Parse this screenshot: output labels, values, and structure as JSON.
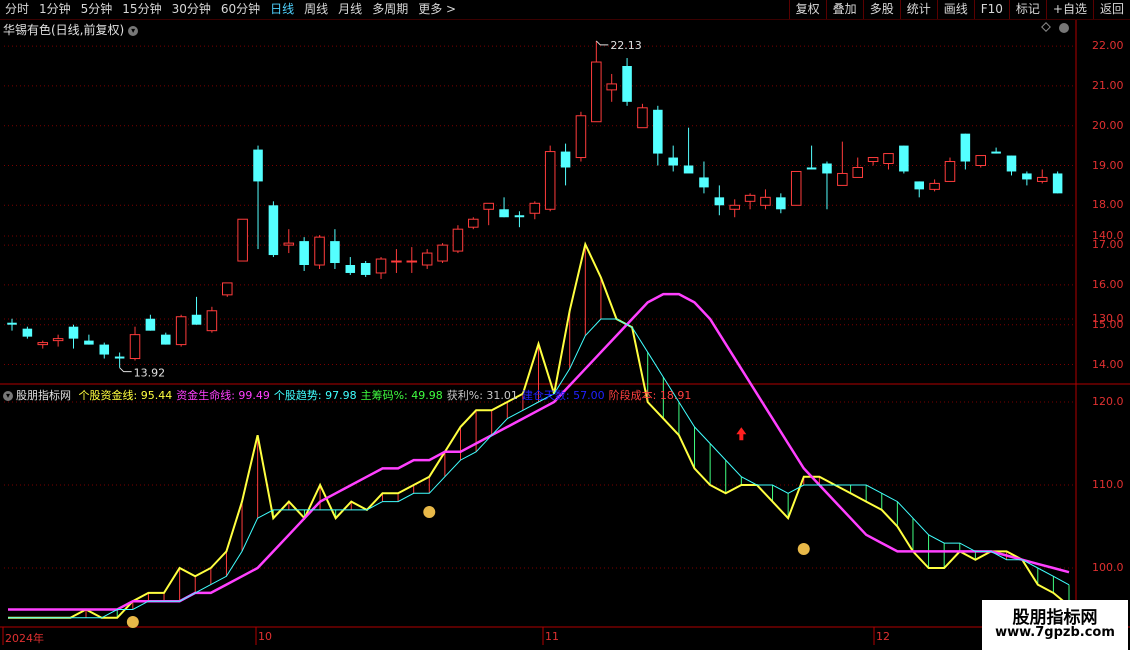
{
  "toolbar": {
    "periods": [
      "分时",
      "1分钟",
      "5分钟",
      "15分钟",
      "30分钟",
      "60分钟",
      "日线",
      "周线",
      "月线",
      "多周期",
      "更多 >"
    ],
    "active_period": "日线",
    "right_buttons": [
      "复权",
      "叠加",
      "多股",
      "统计",
      "画线",
      "F10",
      "标记",
      "+自选",
      "返回"
    ]
  },
  "main_title": "华锡有色(日线,前复权)",
  "price_axis": [
    "22.00",
    "21.00",
    "20.00",
    "19.00",
    "18.00",
    "17.00",
    "16.00",
    "15.00",
    "14.00"
  ],
  "price_high_label": "22.13",
  "price_low_label": "13.92",
  "indicator": {
    "name": "股朋指标网",
    "items": [
      {
        "label": "个股资金线: ",
        "value": "95.44",
        "color": "#ffff40"
      },
      {
        "label": "资金生命线: ",
        "value": "99.49",
        "color": "#ff40ff"
      },
      {
        "label": "个股趋势: ",
        "value": "97.98",
        "color": "#40ffff"
      },
      {
        "label": "主筹码%: ",
        "value": "49.98",
        "color": "#40ff40"
      },
      {
        "label": "获利%: ",
        "value": "31.01",
        "color": "#c8c8c8"
      },
      {
        "label": "建仓天数: ",
        "value": "57.00",
        "color": "#2020ff"
      },
      {
        "label": "阶段成本: ",
        "value": "18.91",
        "color": "#ff4040"
      }
    ]
  },
  "indicator_axis": [
    "140.0",
    "130.0",
    "120.0",
    "110.0",
    "100.0"
  ],
  "date_axis": [
    "2024年",
    "10",
    "11",
    "12"
  ],
  "watermark": {
    "line1": "股朋指标网",
    "line2": "www.7gpzb.com"
  },
  "colors": {
    "up": "#ff3c3c",
    "down": "#54ffff",
    "grid": "#7a0000",
    "axis": "#b00000"
  },
  "chart_data": {
    "type": "candlestick",
    "note": "daily OHLC, prices in CNY",
    "ohlc": [
      [
        15.05,
        15.15,
        14.85,
        15.0
      ],
      [
        14.9,
        14.95,
        14.65,
        14.7
      ],
      [
        14.5,
        14.6,
        14.4,
        14.55
      ],
      [
        14.6,
        14.75,
        14.45,
        14.65
      ],
      [
        14.95,
        15.0,
        14.4,
        14.65
      ],
      [
        14.6,
        14.75,
        14.5,
        14.5
      ],
      [
        14.5,
        14.55,
        14.15,
        14.25
      ],
      [
        14.2,
        14.3,
        13.92,
        14.15
      ],
      [
        14.15,
        14.95,
        14.1,
        14.75
      ],
      [
        15.15,
        15.25,
        14.85,
        14.85
      ],
      [
        14.75,
        14.8,
        14.5,
        14.5
      ],
      [
        14.5,
        15.25,
        14.45,
        15.2
      ],
      [
        15.25,
        15.7,
        15.0,
        15.0
      ],
      [
        14.85,
        15.45,
        14.8,
        15.35
      ],
      [
        15.75,
        16.05,
        15.7,
        16.05
      ],
      [
        16.6,
        17.65,
        16.6,
        17.65
      ],
      [
        19.4,
        19.5,
        16.9,
        18.6
      ],
      [
        18.0,
        18.1,
        16.7,
        16.75
      ],
      [
        17.0,
        17.4,
        16.8,
        17.05
      ],
      [
        17.1,
        17.2,
        16.35,
        16.5
      ],
      [
        16.5,
        17.25,
        16.4,
        17.2
      ],
      [
        17.1,
        17.4,
        16.4,
        16.55
      ],
      [
        16.5,
        16.7,
        16.25,
        16.3
      ],
      [
        16.55,
        16.6,
        16.2,
        16.25
      ],
      [
        16.3,
        16.7,
        16.15,
        16.65
      ],
      [
        16.6,
        16.9,
        16.3,
        16.6
      ],
      [
        16.6,
        16.95,
        16.3,
        16.6
      ],
      [
        16.5,
        16.9,
        16.4,
        16.8
      ],
      [
        16.6,
        17.05,
        16.55,
        17.0
      ],
      [
        16.85,
        17.5,
        16.8,
        17.4
      ],
      [
        17.45,
        17.7,
        17.4,
        17.65
      ],
      [
        17.9,
        18.05,
        17.5,
        18.05
      ],
      [
        17.9,
        18.2,
        17.7,
        17.7
      ],
      [
        17.75,
        17.85,
        17.45,
        17.7
      ],
      [
        17.8,
        18.1,
        17.65,
        18.05
      ],
      [
        17.9,
        19.5,
        17.85,
        19.35
      ],
      [
        19.35,
        19.55,
        18.5,
        18.95
      ],
      [
        19.2,
        20.35,
        19.1,
        20.25
      ],
      [
        20.1,
        22.13,
        20.1,
        21.6
      ],
      [
        20.9,
        21.3,
        20.6,
        21.05
      ],
      [
        21.5,
        21.7,
        20.5,
        20.6
      ],
      [
        19.95,
        20.55,
        19.95,
        20.45
      ],
      [
        20.4,
        20.5,
        19.0,
        19.3
      ],
      [
        19.2,
        19.5,
        18.85,
        19.0
      ],
      [
        19.0,
        19.95,
        18.9,
        18.8
      ],
      [
        18.7,
        19.1,
        18.3,
        18.45
      ],
      [
        18.2,
        18.5,
        17.75,
        18.0
      ],
      [
        17.9,
        18.15,
        17.7,
        18.0
      ],
      [
        18.1,
        18.3,
        17.9,
        18.25
      ],
      [
        18.0,
        18.4,
        17.9,
        18.2
      ],
      [
        18.2,
        18.3,
        17.8,
        17.9
      ],
      [
        18.0,
        18.8,
        18.0,
        18.85
      ],
      [
        18.95,
        19.5,
        18.9,
        18.9
      ],
      [
        19.05,
        19.1,
        17.9,
        18.8
      ],
      [
        18.5,
        19.6,
        18.5,
        18.8
      ],
      [
        18.7,
        19.2,
        18.7,
        18.95
      ],
      [
        19.1,
        19.2,
        19.0,
        19.2
      ],
      [
        19.05,
        19.1,
        18.9,
        19.3
      ],
      [
        19.5,
        19.5,
        18.8,
        18.85
      ],
      [
        18.6,
        18.6,
        18.2,
        18.4
      ],
      [
        18.4,
        18.65,
        18.35,
        18.55
      ],
      [
        18.6,
        19.2,
        18.6,
        19.1
      ],
      [
        19.8,
        19.8,
        18.9,
        19.1
      ],
      [
        19.0,
        19.2,
        18.95,
        19.25
      ],
      [
        19.35,
        19.45,
        19.3,
        19.3
      ],
      [
        19.25,
        19.25,
        18.75,
        18.85
      ],
      [
        18.8,
        18.85,
        18.5,
        18.65
      ],
      [
        18.6,
        18.9,
        18.55,
        18.7
      ],
      [
        18.8,
        18.85,
        18.3,
        18.3
      ]
    ],
    "indicator_series": [
      {
        "name": "个股资金线",
        "color": "#ffff40",
        "values": [
          94,
          94,
          94,
          94,
          94,
          95,
          94,
          94,
          96,
          97,
          97,
          100,
          99,
          100,
          102,
          108,
          116,
          106,
          108,
          106,
          110,
          106,
          108,
          107,
          109,
          109,
          110,
          111,
          114,
          117,
          119,
          119,
          120,
          121,
          127,
          121,
          131,
          139,
          135,
          130,
          129,
          120,
          118,
          116,
          112,
          110,
          109,
          110,
          110,
          108,
          106,
          111,
          111,
          110,
          109,
          108,
          107,
          105,
          102,
          100,
          100,
          102,
          101,
          102,
          102,
          101,
          98,
          97,
          95.44
        ]
      },
      {
        "name": "资金生命线",
        "color": "#ff40ff",
        "values": [
          95,
          95,
          95,
          95,
          95,
          95,
          95,
          95,
          96,
          96,
          96,
          96,
          97,
          97,
          98,
          99,
          100,
          102,
          104,
          106,
          108,
          109,
          110,
          111,
          112,
          112,
          113,
          113,
          114,
          114,
          115,
          116,
          117,
          118,
          119,
          120,
          122,
          124,
          126,
          128,
          130,
          132,
          133,
          133,
          132,
          130,
          127,
          124,
          121,
          118,
          115,
          112,
          110,
          108,
          106,
          104,
          103,
          102,
          102,
          102,
          102,
          102,
          102,
          102,
          101.5,
          101,
          100.5,
          100,
          99.49
        ]
      },
      {
        "name": "个股趋势",
        "color": "#40ffff",
        "values": [
          94,
          94,
          94,
          94,
          94,
          94,
          94,
          95,
          95,
          96,
          96,
          96,
          97,
          98,
          99,
          102,
          106,
          107,
          107,
          107,
          107,
          107,
          107,
          107,
          108,
          108,
          109,
          109,
          111,
          113,
          114,
          116,
          118,
          119,
          120,
          121,
          124,
          128,
          130,
          130,
          129,
          126,
          123,
          120,
          117,
          115,
          113,
          111,
          110,
          110,
          109,
          110,
          110,
          110,
          110,
          110,
          109,
          108,
          106,
          104,
          103,
          103,
          102,
          102,
          101,
          101,
          100,
          99,
          97.98
        ]
      }
    ]
  }
}
